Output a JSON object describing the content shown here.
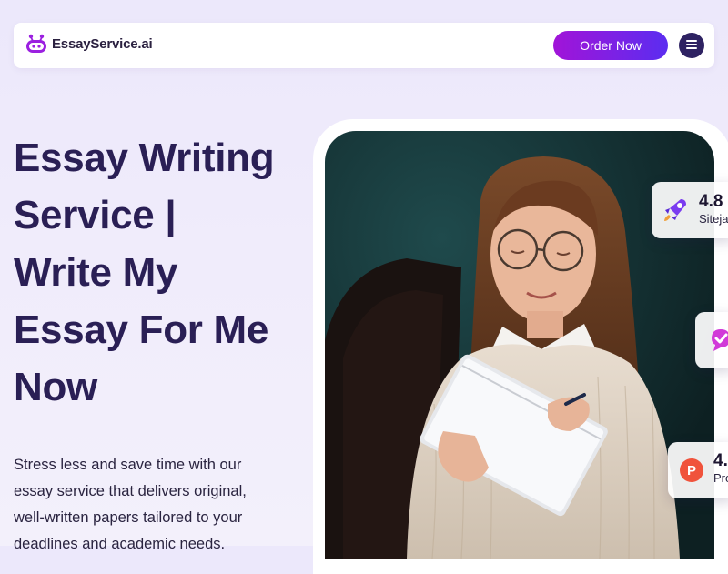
{
  "brand": {
    "name": "EssayService.ai"
  },
  "header": {
    "order_label": "Order Now"
  },
  "hero": {
    "title_lines": [
      "Essay Writing",
      "Service |",
      "Write My",
      "Essay For Me",
      "Now"
    ],
    "description_lines": [
      "Stress less and save time with our",
      "essay service that delivers original,",
      "well-written papers tailored to your",
      "deadlines and academic needs."
    ]
  },
  "ratings": [
    {
      "score": "4.8",
      "site": "Sitejabber",
      "icon": "rocket-icon"
    },
    {
      "score": "",
      "site": "",
      "icon": "check-badge-icon"
    },
    {
      "score": "4.",
      "site": "Pro",
      "icon": "p-logo-icon"
    }
  ],
  "colors": {
    "brand_dark": "#2a1f55",
    "cta_gradient_start": "#a114d8",
    "cta_gradient_end": "#5b2df0",
    "menu_button": "#2e2262",
    "background": "#ece8fb"
  }
}
